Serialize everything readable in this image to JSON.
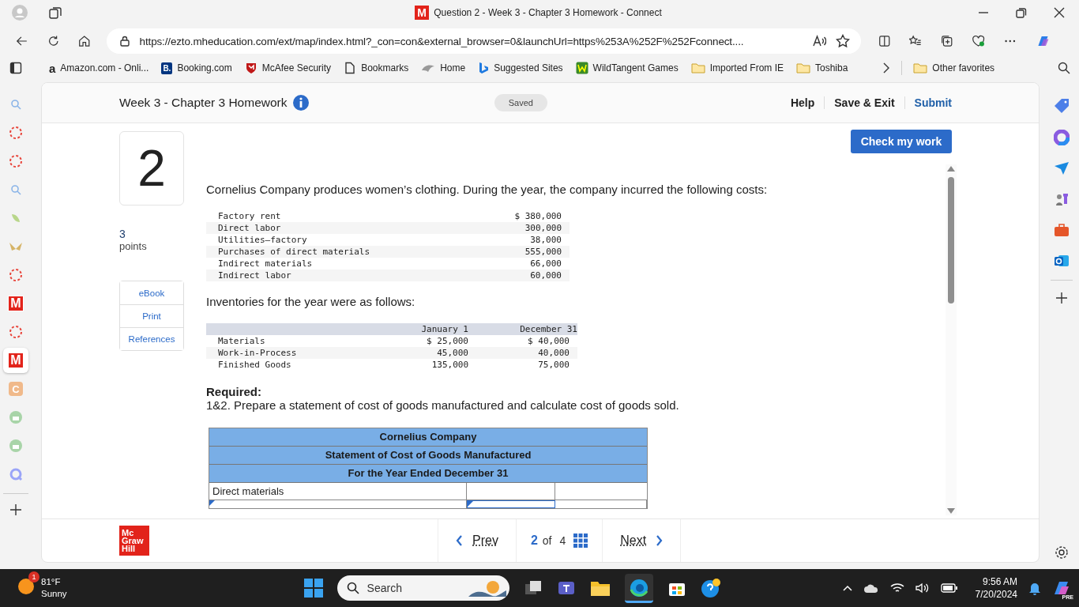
{
  "window": {
    "title": "Question 2 - Week 3 - Chapter 3 Homework - Connect",
    "logo_letter": "M"
  },
  "address_bar": {
    "url": "https://ezto.mheducation.com/ext/map/index.html?_con=con&external_browser=0&launchUrl=https%253A%252F%252Fconnect...."
  },
  "bookmarks": [
    {
      "label": "Amazon.com - Onli...",
      "kind": "letter",
      "icon_text": "a"
    },
    {
      "label": "Booking.com",
      "kind": "badge",
      "icon_text": "B."
    },
    {
      "label": "McAfee Security",
      "kind": "shield"
    },
    {
      "label": "Bookmarks",
      "kind": "page"
    },
    {
      "label": "Home",
      "kind": "bird"
    },
    {
      "label": "Suggested Sites",
      "kind": "bing"
    },
    {
      "label": "WildTangent Games",
      "kind": "wt"
    },
    {
      "label": "Imported From IE",
      "kind": "folder"
    },
    {
      "label": "Toshiba",
      "kind": "folder"
    }
  ],
  "other_favorites": "Other favorites",
  "left_sidebar": [
    {
      "kind": "search",
      "selected": false
    },
    {
      "kind": "ring",
      "selected": false
    },
    {
      "kind": "ring",
      "selected": false
    },
    {
      "kind": "search",
      "selected": false
    },
    {
      "kind": "leaf",
      "selected": false
    },
    {
      "kind": "butterfly",
      "selected": false
    },
    {
      "kind": "ring",
      "selected": false
    },
    {
      "kind": "m-logo",
      "letter": "M",
      "selected": false
    },
    {
      "kind": "ring",
      "selected": false
    },
    {
      "kind": "m-logo",
      "letter": "M",
      "selected": true
    },
    {
      "kind": "c-logo",
      "letter": "C",
      "selected": false
    },
    {
      "kind": "robot",
      "selected": false
    },
    {
      "kind": "robot",
      "selected": false
    },
    {
      "kind": "q",
      "selected": false
    }
  ],
  "assignment": {
    "title": "Week 3 - Chapter 3 Homework",
    "saved": "Saved",
    "links": [
      "Help",
      "Save & Exit",
      "Submit"
    ],
    "check_button": "Check my work"
  },
  "question": {
    "number": "2",
    "points": "3",
    "points_label": "points",
    "resources": [
      "eBook",
      "Print",
      "References"
    ],
    "intro": "Cornelius Company produces women’s clothing. During the year, the company incurred the following costs:",
    "costs": [
      {
        "label": "Factory rent",
        "amount": "$ 380,000"
      },
      {
        "label": "Direct labor",
        "amount": "300,000"
      },
      {
        "label": "Utilities—factory",
        "amount": "38,000"
      },
      {
        "label": "Purchases of direct materials",
        "amount": "555,000"
      },
      {
        "label": "Indirect materials",
        "amount": "66,000"
      },
      {
        "label": "Indirect labor",
        "amount": "60,000"
      }
    ],
    "inventories_intro": "Inventories for the year were as follows:",
    "inventory_columns": [
      "January 1",
      "December 31"
    ],
    "inventory_rows": [
      {
        "label": "Materials",
        "january": "$ 25,000",
        "december": "$ 40,000"
      },
      {
        "label": "Work-in-Process",
        "january": "45,000",
        "december": "40,000"
      },
      {
        "label": "Finished Goods",
        "january": "135,000",
        "december": "75,000"
      }
    ],
    "required_label": "Required:",
    "required_text": "1&2. Prepare a statement of cost of goods manufactured and calculate cost of goods sold.",
    "statement": {
      "headings": [
        "Cornelius Company",
        "Statement of Cost of Goods Manufactured",
        "For the Year Ended December 31"
      ],
      "rows": [
        {
          "kind": "label",
          "label": "Direct materials"
        },
        {
          "kind": "input"
        }
      ]
    }
  },
  "footer": {
    "logo_lines": [
      "Mc",
      "Graw",
      "Hill"
    ],
    "prev": "Prev",
    "current": "2",
    "of": "of",
    "total": "4",
    "next": "Next"
  },
  "taskbar": {
    "badge": "1",
    "temperature": "81°F",
    "condition": "Sunny",
    "search_placeholder": "Search",
    "copilot_badge": "PRE",
    "time": "9:56 AM",
    "date": "7/20/2024"
  }
}
